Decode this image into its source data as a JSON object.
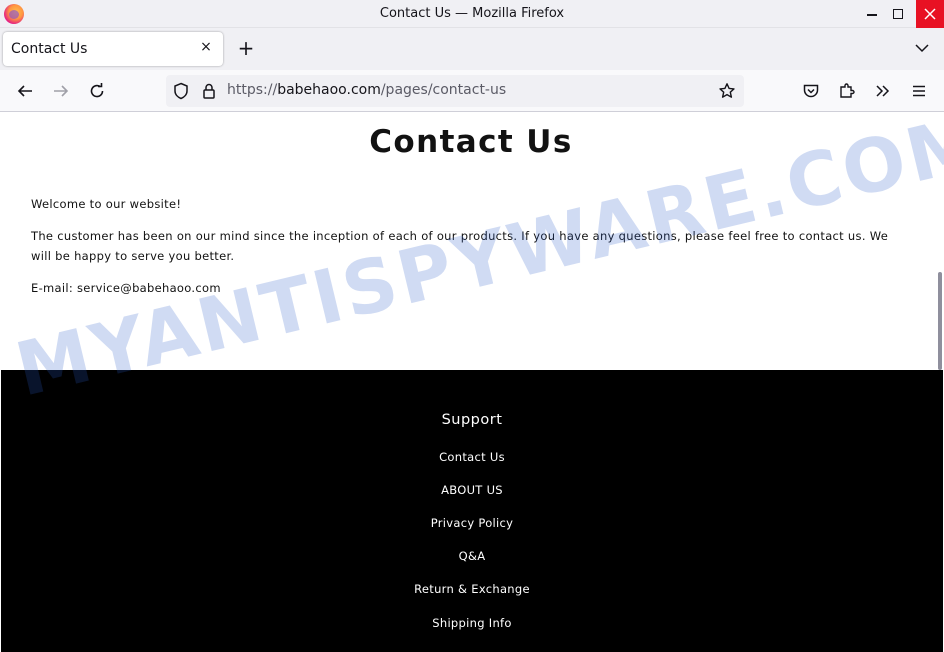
{
  "window": {
    "title": "Contact Us — Mozilla Firefox"
  },
  "tabs": [
    {
      "label": "Contact Us",
      "close": "×"
    }
  ],
  "newtab_label": "+",
  "urlbar": {
    "scheme": "https://",
    "domain": "babehaoo.com",
    "path": "/pages/contact-us"
  },
  "page": {
    "title": "Contact Us",
    "paragraphs": [
      "Welcome to our website!",
      "The customer has been on our mind since the inception of each of our products. If you have any questions, please feel free to contact us. We will be happy to serve you better.",
      "E-mail: service@babehaoo.com"
    ]
  },
  "footer": {
    "heading": "Support",
    "links": [
      "Contact Us",
      "ABOUT US",
      "Privacy Policy",
      "Q&A",
      "Return & Exchange",
      "Shipping Info"
    ]
  },
  "watermark": "MYANTISPYWARE.COM",
  "colors": {
    "close_button": "#e81123",
    "footer_bg": "#000000",
    "watermark": "#285ac8"
  }
}
